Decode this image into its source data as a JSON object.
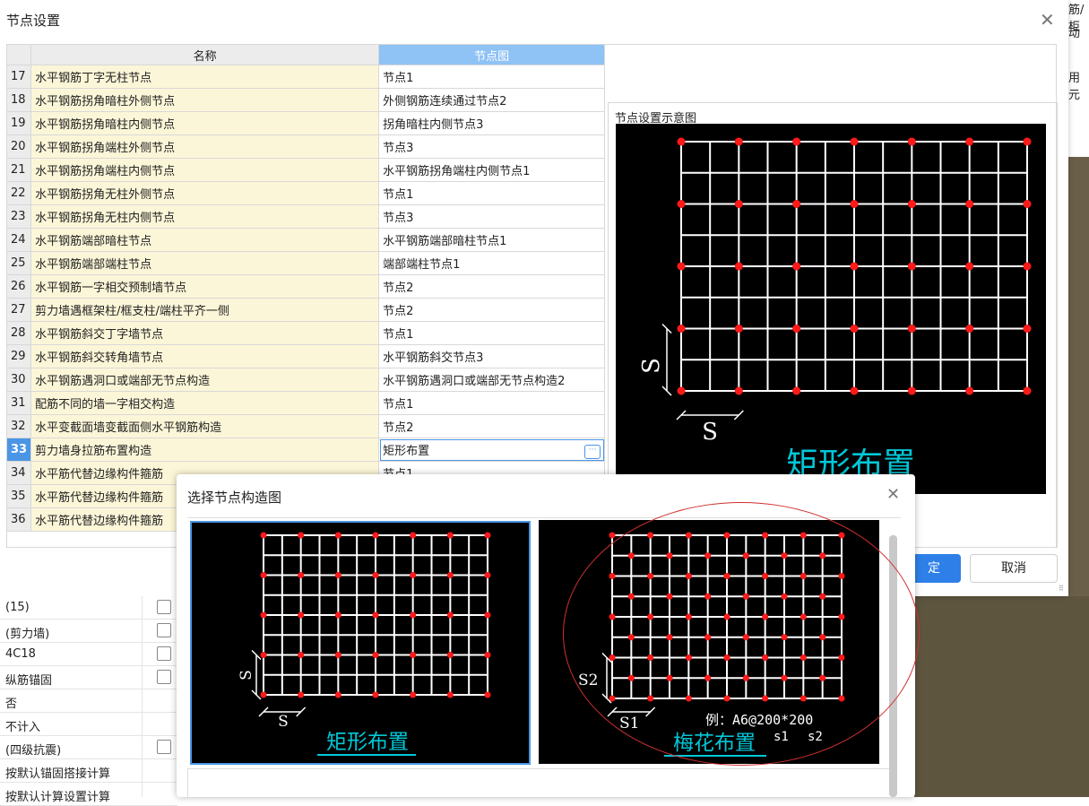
{
  "background": {
    "edge_text": [
      "筋/柜",
      "动",
      "用元"
    ]
  },
  "main_dialog": {
    "title": "节点设置",
    "columns": {
      "name": "名称",
      "diagram": "节点图"
    },
    "rows": [
      {
        "num": "17",
        "name": "水平钢筋丁字无柱节点",
        "value": "节点1"
      },
      {
        "num": "18",
        "name": "水平钢筋拐角暗柱外侧节点",
        "value": "外侧钢筋连续通过节点2"
      },
      {
        "num": "19",
        "name": "水平钢筋拐角暗柱内侧节点",
        "value": "拐角暗柱内侧节点3"
      },
      {
        "num": "20",
        "name": "水平钢筋拐角端柱外侧节点",
        "value": "节点3"
      },
      {
        "num": "21",
        "name": "水平钢筋拐角端柱内侧节点",
        "value": "水平钢筋拐角端柱内侧节点1"
      },
      {
        "num": "22",
        "name": "水平钢筋拐角无柱外侧节点",
        "value": "节点1"
      },
      {
        "num": "23",
        "name": "水平钢筋拐角无柱内侧节点",
        "value": "节点3"
      },
      {
        "num": "24",
        "name": "水平钢筋端部暗柱节点",
        "value": "水平钢筋端部暗柱节点1"
      },
      {
        "num": "25",
        "name": "水平钢筋端部端柱节点",
        "value": "端部端柱节点1"
      },
      {
        "num": "26",
        "name": "水平钢筋一字相交预制墙节点",
        "value": "节点2"
      },
      {
        "num": "27",
        "name": "剪力墙遇框架柱/框支柱/端柱平齐一侧",
        "value": "节点2"
      },
      {
        "num": "28",
        "name": "水平钢筋斜交丁字墙节点",
        "value": "节点1"
      },
      {
        "num": "29",
        "name": "水平钢筋斜交转角墙节点",
        "value": "水平钢筋斜交节点3"
      },
      {
        "num": "30",
        "name": "水平钢筋遇洞口或端部无节点构造",
        "value": "水平钢筋遇洞口或端部无节点构造2"
      },
      {
        "num": "31",
        "name": "配筋不同的墙一字相交构造",
        "value": "节点1"
      },
      {
        "num": "32",
        "name": "水平变截面墙变截面侧水平钢筋构造",
        "value": "节点2"
      },
      {
        "num": "33",
        "name": "剪力墙身拉筋布置构造",
        "value": "矩形布置"
      },
      {
        "num": "34",
        "name": "水平筋代替边缘构件箍筋",
        "value": "节点1"
      },
      {
        "num": "35",
        "name": "水平筋代替边缘构件箍筋",
        "value": ""
      },
      {
        "num": "36",
        "name": "水平筋代替边缘构件箍筋",
        "value": ""
      }
    ],
    "preview_label": "节点设置示意图",
    "preview_caption": "矩形布置",
    "ok_label": "定",
    "cancel_label": "取消"
  },
  "properties": [
    {
      "label": "(15)",
      "checkbox": true
    },
    {
      "label": "(剪力墙)",
      "checkbox": true
    },
    {
      "label": "4C18",
      "checkbox": true
    },
    {
      "label": "纵筋锚固",
      "checkbox": true
    },
    {
      "label": "否",
      "checkbox": false
    },
    {
      "label": "不计入",
      "checkbox": false
    },
    {
      "label": "(四级抗震)",
      "checkbox": true
    },
    {
      "label": "按默认锚固搭接计算",
      "checkbox": false
    },
    {
      "label": "按默认计算设置计算",
      "checkbox": false
    }
  ],
  "select_dialog": {
    "title": "选择节点构造图",
    "options": [
      {
        "caption": "矩形布置",
        "dim_v": "S",
        "dim_h": "S"
      },
      {
        "caption": "梅花布置",
        "dim_v": "S2",
        "dim_h": "S1",
        "example": "例：A6@200*200",
        "s1": "s1",
        "s2": "s2"
      }
    ]
  },
  "colors": {
    "accent": "#2e80e8",
    "selected_row": "#4a95e6",
    "name_bg": "#fcf6d8",
    "caption_cyan": "#00c8d8",
    "dot_red": "#ff1a1a",
    "highlight_ellipse": "#d03030"
  }
}
